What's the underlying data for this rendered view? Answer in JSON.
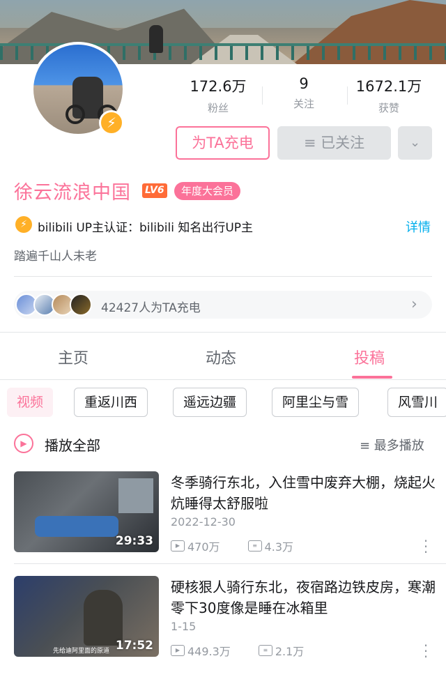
{
  "profile": {
    "name": "徐云流浪中国",
    "level": "LV6",
    "vip_label": "年度大会员",
    "certification": "bilibili UP主认证：bilibili 知名出行UP主",
    "detail_link": "详情",
    "signature": "踏遍千山人未老",
    "badge_icon": "lightning-icon"
  },
  "stats": [
    {
      "value": "172.6万",
      "label": "粉丝"
    },
    {
      "value": "9",
      "label": "关注"
    },
    {
      "value": "1672.1万",
      "label": "获赞"
    }
  ],
  "actions": {
    "charge_label": "为TA充电",
    "follow_label": "≡ 已关注",
    "more_icon": "chevron-down-icon"
  },
  "chargers": {
    "text": "42427人为TA充电"
  },
  "tabs": [
    {
      "label": "主页"
    },
    {
      "label": "动态"
    },
    {
      "label": "投稿"
    }
  ],
  "active_tab": "投稿",
  "chips": [
    {
      "label": "视频"
    },
    {
      "label": "重返川西"
    },
    {
      "label": "遥远边疆"
    },
    {
      "label": "阿里尘与雪"
    },
    {
      "label": "风雪川"
    }
  ],
  "list_header": {
    "play_all": "播放全部",
    "sort": "≡ 最多播放"
  },
  "videos": [
    {
      "title": "冬季骑行东北，入住雪中废弃大棚，烧起火炕睡得太舒服啦",
      "date": "2022-12-30",
      "duration": "29:33",
      "plays": "470万",
      "danmaku": "4.3万"
    },
    {
      "title": "硬核狠人骑行东北，夜宿路边铁皮房，寒潮零下30度像是睡在冰箱里",
      "date": "1-15",
      "duration": "17:52",
      "plays": "449.3万",
      "danmaku": "2.1万",
      "thumb_caption": "先给迪阿里面的原道"
    }
  ],
  "colors": {
    "accent": "#fb7299",
    "link": "#00aeec",
    "gold": "#ffb027",
    "level": "#ff6b37"
  }
}
